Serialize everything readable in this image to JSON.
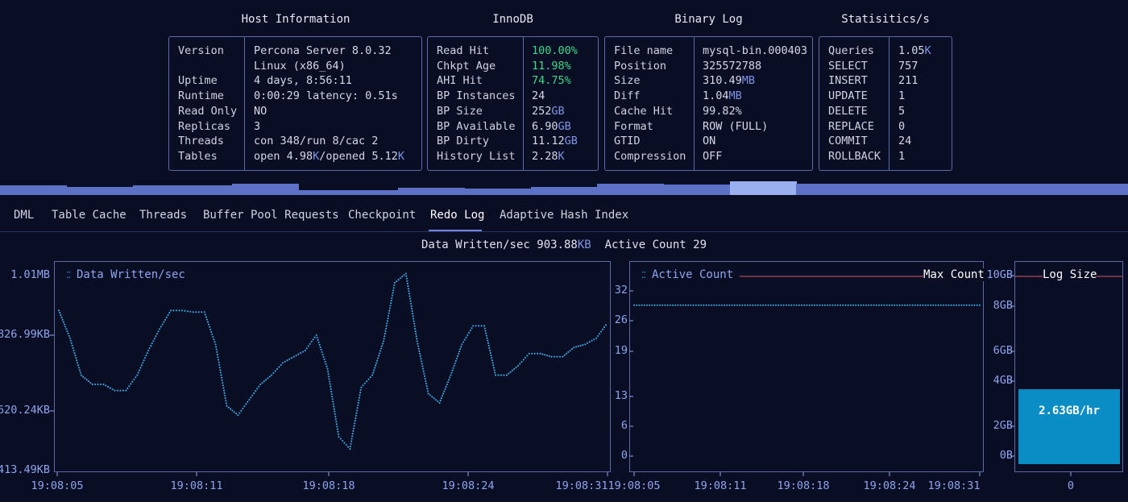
{
  "host": {
    "title": "Host Information",
    "rows": [
      {
        "label": "Version",
        "value": [
          {
            "t": "Percona Server 8.0.32"
          }
        ]
      },
      {
        "label": "",
        "value": [
          {
            "t": "Linux (x86_64)"
          }
        ]
      },
      {
        "label": "Uptime",
        "value": [
          {
            "t": "4 days, 8:56:11"
          }
        ]
      },
      {
        "label": "Runtime",
        "value": [
          {
            "t": "0:00:29 latency: 0.51s"
          }
        ]
      },
      {
        "label": "Read Only",
        "value": [
          {
            "t": "NO"
          }
        ]
      },
      {
        "label": "Replicas",
        "value": [
          {
            "t": "3"
          }
        ]
      },
      {
        "label": "Threads",
        "value": [
          {
            "t": "con 348/run 8/cac 2"
          }
        ]
      },
      {
        "label": "Tables",
        "value": [
          {
            "t": "open 4.98"
          },
          {
            "t": "K",
            "c": "u"
          },
          {
            "t": "/opened 5.12"
          },
          {
            "t": "K",
            "c": "u"
          }
        ]
      }
    ]
  },
  "innodb": {
    "title": "InnoDB",
    "rows": [
      {
        "label": "Read Hit",
        "value": [
          {
            "t": "100.00%",
            "c": "g"
          }
        ]
      },
      {
        "label": "Chkpt Age",
        "value": [
          {
            "t": "11.98%",
            "c": "g"
          }
        ]
      },
      {
        "label": "AHI Hit",
        "value": [
          {
            "t": "74.75%",
            "c": "g"
          }
        ]
      },
      {
        "label": "BP Instances",
        "value": [
          {
            "t": "24"
          }
        ]
      },
      {
        "label": "BP Size",
        "value": [
          {
            "t": "252"
          },
          {
            "t": "GB",
            "c": "u"
          }
        ]
      },
      {
        "label": "BP Available",
        "value": [
          {
            "t": "6.90"
          },
          {
            "t": "GB",
            "c": "u"
          }
        ]
      },
      {
        "label": "BP Dirty",
        "value": [
          {
            "t": "11.12"
          },
          {
            "t": "GB",
            "c": "u"
          }
        ]
      },
      {
        "label": "History List",
        "value": [
          {
            "t": "2.28"
          },
          {
            "t": "K",
            "c": "u"
          }
        ]
      }
    ]
  },
  "binlog": {
    "title": "Binary Log",
    "rows": [
      {
        "label": "File name",
        "value": [
          {
            "t": "mysql-bin.000403"
          }
        ]
      },
      {
        "label": "Position",
        "value": [
          {
            "t": "325572788"
          }
        ]
      },
      {
        "label": "Size",
        "value": [
          {
            "t": "310.49"
          },
          {
            "t": "MB",
            "c": "u"
          }
        ]
      },
      {
        "label": "Diff",
        "value": [
          {
            "t": "1.04"
          },
          {
            "t": "MB",
            "c": "u"
          }
        ]
      },
      {
        "label": "Cache Hit",
        "value": [
          {
            "t": "99.82%"
          }
        ]
      },
      {
        "label": "Format",
        "value": [
          {
            "t": "ROW (FULL)"
          }
        ]
      },
      {
        "label": "GTID",
        "value": [
          {
            "t": "ON"
          }
        ]
      },
      {
        "label": "Compression",
        "value": [
          {
            "t": "OFF"
          }
        ]
      }
    ]
  },
  "stats": {
    "title": "Statisitics/s",
    "rows": [
      {
        "label": "Queries",
        "value": [
          {
            "t": "1.05"
          },
          {
            "t": "K",
            "c": "u"
          }
        ]
      },
      {
        "label": "SELECT",
        "value": [
          {
            "t": "757"
          }
        ]
      },
      {
        "label": "INSERT",
        "value": [
          {
            "t": "211"
          }
        ]
      },
      {
        "label": "UPDATE",
        "value": [
          {
            "t": "1"
          }
        ]
      },
      {
        "label": "DELETE",
        "value": [
          {
            "t": "5"
          }
        ]
      },
      {
        "label": "REPLACE",
        "value": [
          {
            "t": "0"
          }
        ]
      },
      {
        "label": "COMMIT",
        "value": [
          {
            "t": "24"
          }
        ]
      },
      {
        "label": "ROLLBACK",
        "value": [
          {
            "t": "1"
          }
        ]
      }
    ]
  },
  "activity_strip": {
    "levels": [
      0.45,
      0.45,
      0.3,
      0.3,
      0.4,
      0.4,
      0.4,
      0.55,
      0.55,
      0.0,
      0.0,
      0.0,
      0.25,
      0.25,
      0.15,
      0.15,
      0.3,
      0.3,
      0.6,
      0.6,
      0.5,
      0.5,
      0.8,
      0.8,
      0.55,
      0.55,
      0.55,
      0.55,
      0.55,
      0.55,
      0.55,
      0.55,
      0.6,
      0.6
    ]
  },
  "tabs": [
    {
      "label": "DML"
    },
    {
      "label": "Table Cache"
    },
    {
      "label": "Threads"
    },
    {
      "label": "Buffer Pool Requests"
    },
    {
      "label": "Checkpoint"
    },
    {
      "label": "Redo Log",
      "active": true
    },
    {
      "label": "Adaptive Hash Index"
    }
  ],
  "summary": {
    "data_written_label": "Data Written/sec",
    "data_written_value": "903.88",
    "data_written_unit": "KB",
    "active_count_label": "Active Count",
    "active_count_value": "29"
  },
  "colors": {
    "accent": "#7e95e6",
    "green": "#3fd98a",
    "series": "#3fa9e6",
    "max_line": "#e05563",
    "log_bar": "#0a8cc4"
  },
  "chart_data": [
    {
      "type": "line",
      "legend": "Data Written/sec",
      "y_ticks": [
        "1.01MB",
        "826.99KB",
        "620.24KB",
        "413.49KB"
      ],
      "x_ticks": [
        "19:08:05",
        "19:08:11",
        "19:08:18",
        "19:08:24",
        "19:08:31"
      ],
      "ylim_kb": [
        413.49,
        1034
      ],
      "series": [
        {
          "name": "Data Written/sec",
          "unit": "KB",
          "values": [
            910,
            820,
            700,
            670,
            670,
            650,
            650,
            700,
            780,
            850,
            910,
            910,
            905,
            905,
            800,
            600,
            570,
            620,
            670,
            700,
            740,
            760,
            780,
            830,
            720,
            500,
            460,
            660,
            700,
            810,
            1000,
            1030,
            810,
            640,
            610,
            700,
            800,
            860,
            860,
            700,
            700,
            730,
            770,
            770,
            760,
            760,
            790,
            800,
            820,
            870
          ]
        }
      ]
    },
    {
      "type": "line",
      "legend": "Active Count",
      "max_label": "Max Count",
      "y_ticks": [
        "32",
        "26",
        "19",
        "13",
        "6",
        "0"
      ],
      "x_ticks": [
        "19:08:05",
        "19:08:11",
        "19:08:18",
        "19:08:24",
        "19:08:31"
      ],
      "ylim": [
        0,
        35
      ],
      "series": [
        {
          "name": "Active Count",
          "values": [
            29,
            29,
            29,
            29,
            29,
            29,
            29,
            29,
            29,
            29
          ]
        }
      ]
    },
    {
      "type": "bar",
      "title": "Log Size",
      "y_ticks": [
        "10GB",
        "8GB",
        "6GB",
        "4GB",
        "2GB",
        "0B"
      ],
      "x_ticks": [
        "0"
      ],
      "ylim_gb": [
        0,
        10
      ],
      "bar_label": "2.63GB/hr",
      "values": [
        4.0
      ]
    }
  ]
}
